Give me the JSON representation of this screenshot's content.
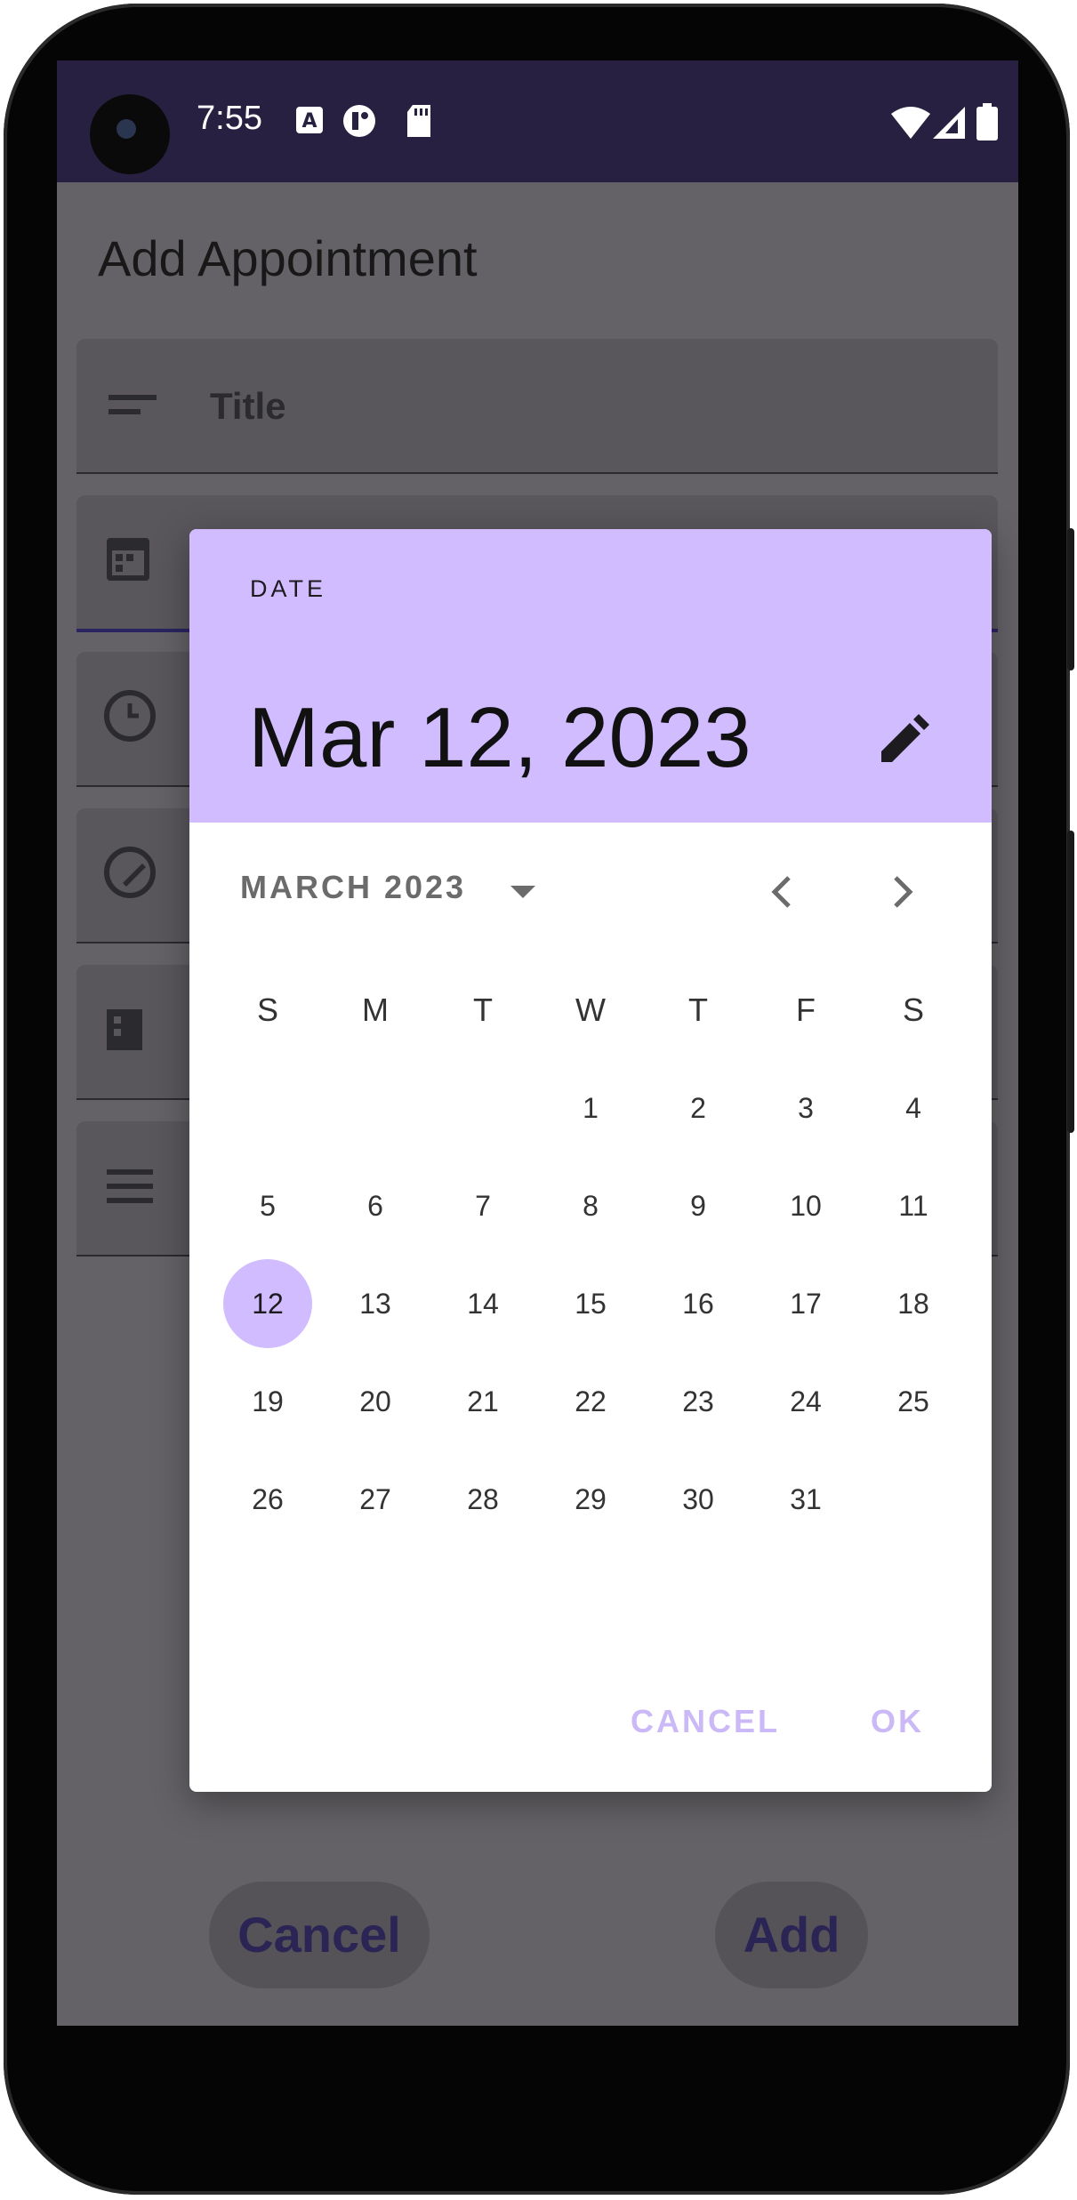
{
  "status_bar": {
    "time": "7:55",
    "icons": [
      "font-icon",
      "circle-status-icon",
      "sd-card-icon",
      "wifi-icon",
      "signal-icon",
      "battery-icon"
    ]
  },
  "app": {
    "title": "Add Appointment",
    "fields": [
      {
        "label": "Title",
        "icon": "text-lines-icon"
      },
      {
        "label": "",
        "icon": "calendar-icon"
      },
      {
        "label": "",
        "icon": "clock-icon"
      },
      {
        "label": "",
        "icon": "palette-icon"
      },
      {
        "label": "",
        "icon": "building-icon"
      },
      {
        "label": "",
        "icon": "notes-icon"
      }
    ],
    "cancel_label": "Cancel",
    "add_label": "Add"
  },
  "dialog": {
    "header_label": "DATE",
    "selected_date": "Mar 12, 2023",
    "month_label": "MARCH 2023",
    "weekdays": [
      "S",
      "M",
      "T",
      "W",
      "T",
      "F",
      "S"
    ],
    "days": [
      "1",
      "2",
      "3",
      "4",
      "5",
      "6",
      "7",
      "8",
      "9",
      "10",
      "11",
      "12",
      "13",
      "14",
      "15",
      "16",
      "17",
      "18",
      "19",
      "20",
      "21",
      "22",
      "23",
      "24",
      "25",
      "26",
      "27",
      "28",
      "29",
      "30",
      "31"
    ],
    "first_weekday_index": 3,
    "selected_day": "12",
    "cancel_label": "CANCEL",
    "ok_label": "OK"
  },
  "colors": {
    "dialog_header": "#d0bcff",
    "status_bar": "#272040",
    "scrim": "#646266",
    "action_text": "#cbb8f6"
  }
}
